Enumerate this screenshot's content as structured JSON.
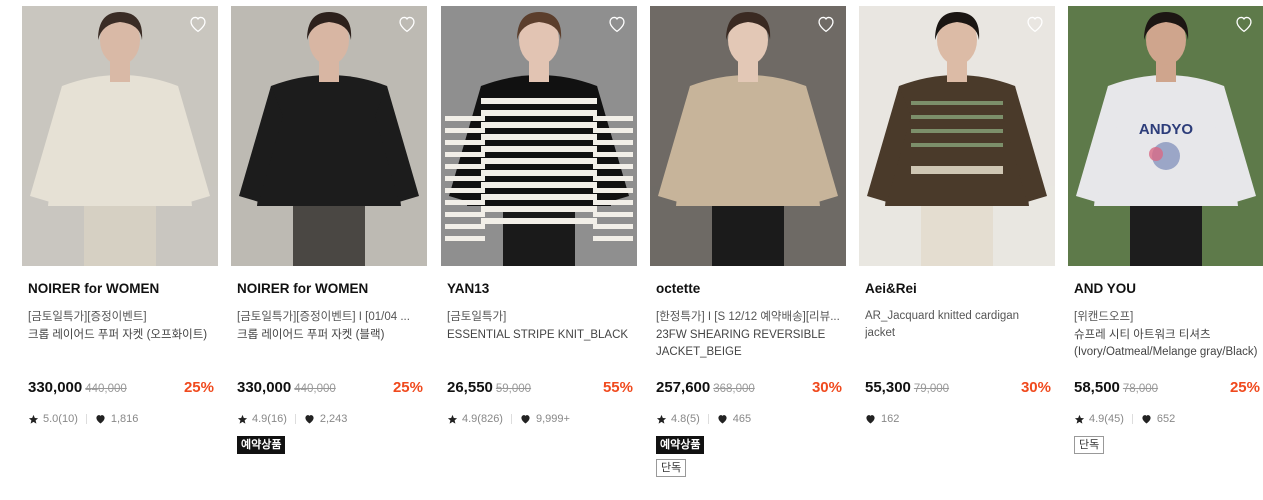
{
  "products": [
    {
      "brand": "NOIRER for WOMEN",
      "tagline": "[금토일특가][증정이벤트]",
      "name": "크롭 레이어드 푸퍼 자켓 (오프화이트)",
      "price": "330,000",
      "original_price": "440,000",
      "discount": "25%",
      "rating": "5.0(10)",
      "likes": "1,816",
      "badges": [],
      "photo": {
        "bg": "#c9c6bf",
        "garment": "#e6e1d5",
        "skin": "#d9b9a6",
        "hair": "#3a2c25",
        "pants": "#d6d0c3"
      }
    },
    {
      "brand": "NOIRER for WOMEN",
      "tagline": "[금토일특가][증정이벤트] I [01/04 ...",
      "name": "크롭 레이어드 푸퍼 자켓 (블랙)",
      "price": "330,000",
      "original_price": "440,000",
      "discount": "25%",
      "rating": "4.9(16)",
      "likes": "2,243",
      "badges": [
        {
          "label": "예약상품",
          "style": "black"
        }
      ],
      "photo": {
        "bg": "#bdbab3",
        "garment": "#1c1c1c",
        "skin": "#d8b6a3",
        "hair": "#2d211c",
        "pants": "#4a4743"
      }
    },
    {
      "brand": "YAN13",
      "tagline": "[금토일특가]",
      "name": "ESSENTIAL STRIPE KNIT_BLACK",
      "price": "26,550",
      "original_price": "59,000",
      "discount": "55%",
      "rating": "4.9(826)",
      "likes": "9,999+",
      "badges": [],
      "photo": {
        "bg": "#8f8f8f",
        "garment": "#111111",
        "skin": "#e2c4b3",
        "hair": "#5b3e2c",
        "pants": "#1a1a1a"
      }
    },
    {
      "brand": "octette",
      "tagline": "[한정특가] I [S 12/12 예약배송][리뷰...",
      "name": "23FW SHEARING REVERSIBLE JACKET_BEIGE",
      "price": "257,600",
      "original_price": "368,000",
      "discount": "30%",
      "rating": "4.8(5)",
      "likes": "465",
      "badges": [
        {
          "label": "예약상품",
          "style": "black"
        },
        {
          "label": "단독",
          "style": "outline"
        }
      ],
      "photo": {
        "bg": "#6f6a65",
        "garment": "#c7b49a",
        "skin": "#e3c8b6",
        "hair": "#3a2a22",
        "pants": "#1b1b1b"
      }
    },
    {
      "brand": "Aei&Rei",
      "tagline": "AR_Jacquard knitted cardigan jacket",
      "name": "",
      "price": "55,300",
      "original_price": "79,000",
      "discount": "30%",
      "rating": "",
      "likes": "162",
      "badges": [],
      "photo": {
        "bg": "#e9e6e1",
        "garment": "#4a3a2a",
        "skin": "#dcbba6",
        "hair": "#1a1512",
        "pants": "#e4ddd0"
      }
    },
    {
      "brand": "AND YOU",
      "tagline": "[위캔드오프]",
      "name": "슈프레 시티 아트워크 티셔츠 (Ivory/Oatmeal/Melange gray/Black)",
      "price": "58,500",
      "original_price": "78,000",
      "discount": "25%",
      "rating": "4.9(45)",
      "likes": "652",
      "badges": [
        {
          "label": "단독",
          "style": "outline"
        }
      ],
      "photo": {
        "bg": "#5e7a4a",
        "garment": "#e7e7ea",
        "skin": "#cfa58d",
        "hair": "#1c1613",
        "pants": "#1d1d1d"
      }
    }
  ]
}
